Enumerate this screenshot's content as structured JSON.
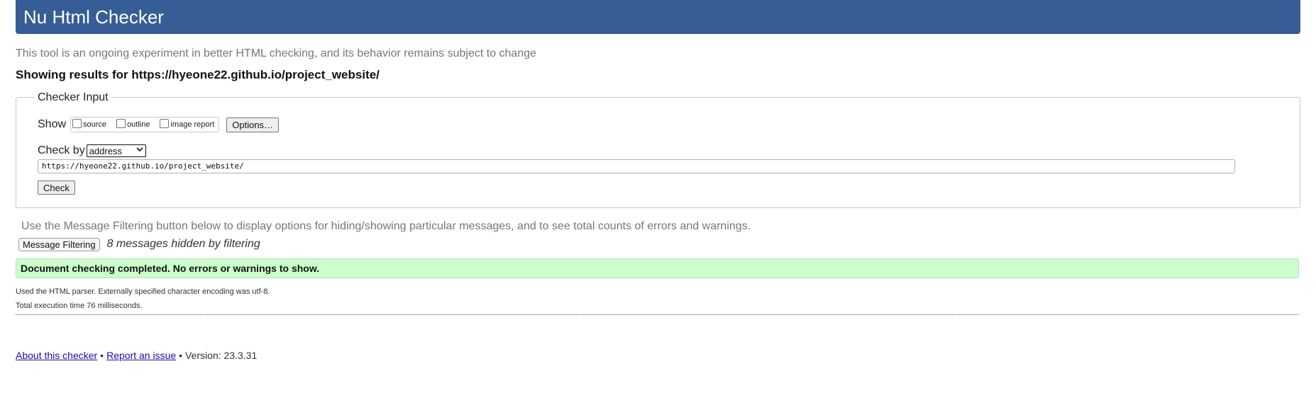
{
  "header": {
    "title": "Nu Html Checker",
    "bg_color": "#365d95"
  },
  "intro": "This tool is an ongoing experiment in better HTML checking, and its behavior remains subject to change",
  "showing": {
    "prefix": "Showing results for",
    "url": "https://hyeone22.github.io/project_website/"
  },
  "checker_input": {
    "legend": "Checker Input",
    "show_label": "Show",
    "show_options": [
      {
        "label": "source",
        "checked": false
      },
      {
        "label": "outline",
        "checked": false
      },
      {
        "label": "image report",
        "checked": false
      }
    ],
    "options_button": "Options…",
    "check_by_label": "Check by",
    "check_by_selected": "address",
    "url_value": "https://hyeone22.github.io/project_website/",
    "check_button": "Check"
  },
  "filter": {
    "info": "Use the Message Filtering button below to display options for hiding/showing particular messages, and to see total counts of errors and warnings.",
    "button": "Message Filtering",
    "hidden_message": "8 messages hidden by filtering"
  },
  "result": {
    "success": "Document checking completed. No errors or warnings to show.",
    "success_color": "#ccffcc",
    "parser_info": "Used the HTML parser. Externally specified character encoding was utf-8.",
    "execution_time": "Total execution time 76 milliseconds."
  },
  "footer": {
    "about_link": "About this checker",
    "separator": "•",
    "report_link": "Report an issue",
    "version": "Version: 23.3.31"
  }
}
